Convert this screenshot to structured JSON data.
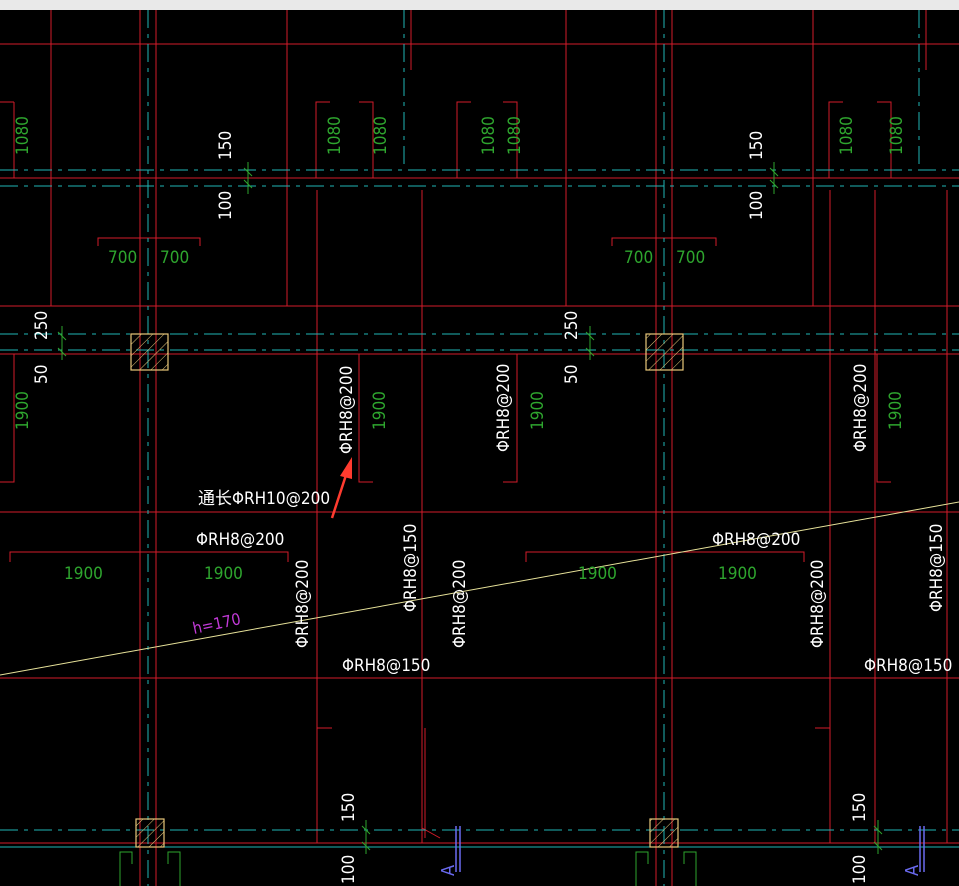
{
  "colors": {
    "background": "#000000",
    "top_bar": "#e9e9e9",
    "red_line": "#d21b2a",
    "cyan_dash": "#1fb6b6",
    "green_text": "#2ea52e",
    "white_text": "#ffffff",
    "magenta_text": "#c23ad8",
    "yellow_line": "#e8e39a",
    "column_outline": "#e8c87a",
    "blue_mark": "#6a6af0",
    "arrow": "#ff3b2f"
  },
  "labels": {
    "dim_1080": "1080",
    "dim_150": "150",
    "dim_100": "100",
    "dim_700": "700",
    "dim_250": "250",
    "dim_50": "50",
    "dim_1900": "1900",
    "rebar_rh8_200": "ΦRH8@200",
    "rebar_rh8_150": "ΦRH8@150",
    "rebar_long_rh10_200": "通长ΦRH10@200",
    "slab_thickness": "h=170",
    "section_mark": "A"
  }
}
